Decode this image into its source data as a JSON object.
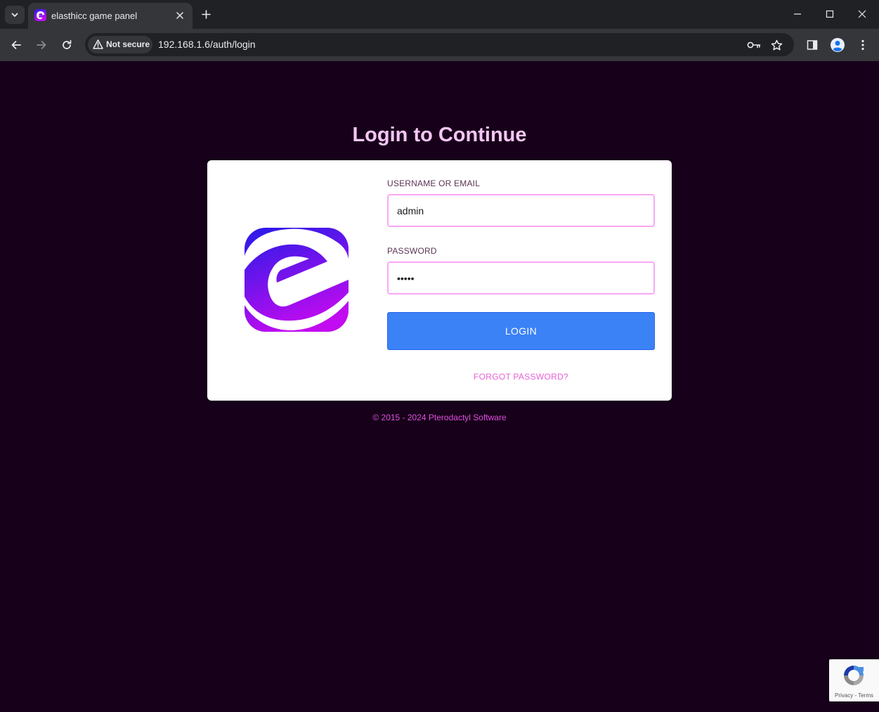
{
  "browser": {
    "tab_title": "elasthicc game panel",
    "security_label": "Not secure",
    "url": "192.168.1.6/auth/login"
  },
  "page": {
    "heading": "Login to Continue",
    "username_label": "USERNAME OR EMAIL",
    "username_value": "admin",
    "password_label": "PASSWORD",
    "password_value": "admin",
    "login_button": "LOGIN",
    "forgot_link": "FORGOT PASSWORD?",
    "footer": "© 2015 - 2024 Pterodactyl Software"
  },
  "recaptcha": {
    "privacy": "Privacy",
    "separator": " - ",
    "terms": "Terms"
  },
  "colors": {
    "page_background": "#17001a",
    "heading": "#f5c6f5",
    "input_border": "#f9a8f4",
    "button": "#3b82f6",
    "link": "#e85ed6",
    "footer": "#e04fe0",
    "logo_gradient_start": "#2a1be8",
    "logo_gradient_end": "#c20bf0"
  },
  "icons": {
    "tab_search": "chevron-down-icon",
    "favicon": "elasthicc-logo-icon",
    "tab_close": "close-icon",
    "new_tab": "plus-icon",
    "back": "arrow-left-icon",
    "forward": "arrow-right-icon",
    "reload": "reload-icon",
    "warning": "warning-triangle-icon",
    "password_key": "key-icon",
    "bookmark": "star-icon",
    "side_panel": "side-panel-icon",
    "profile": "profile-icon",
    "menu": "kebab-menu-icon"
  }
}
